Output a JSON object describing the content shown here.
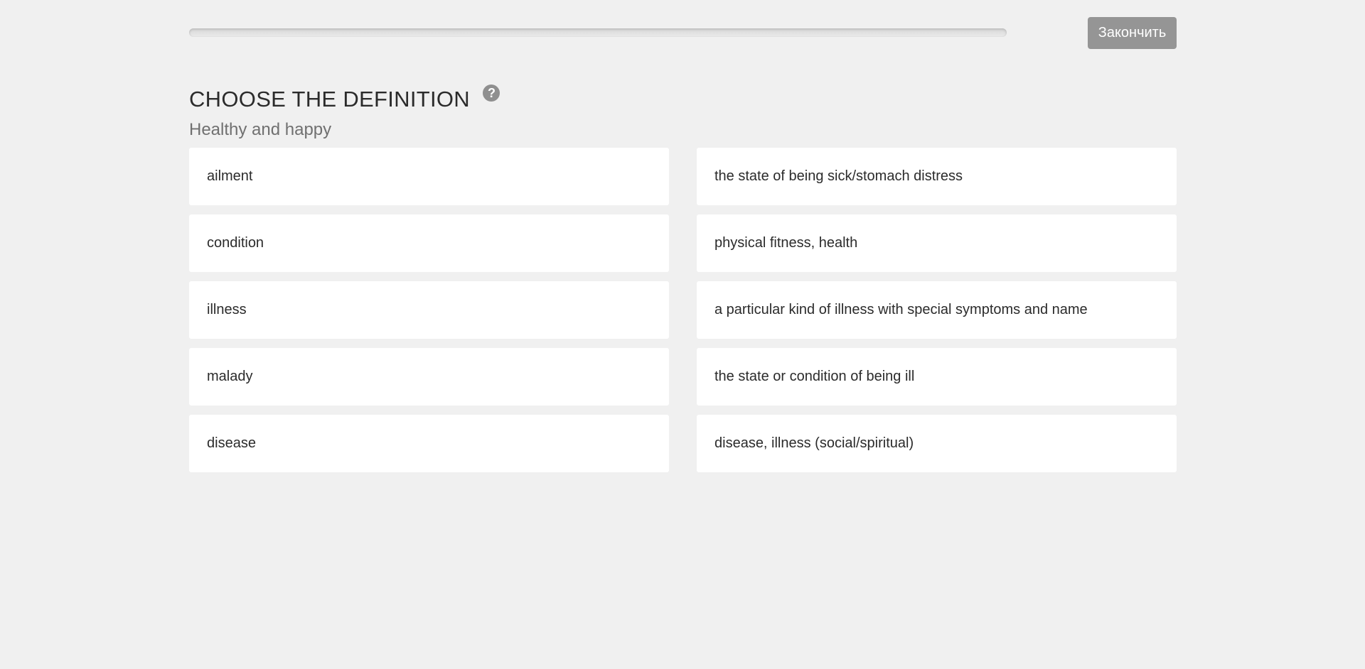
{
  "header": {
    "progress": 0,
    "finish_label": "Закончить"
  },
  "title": "CHOOSE THE DEFINITION",
  "help_icon": "question-circle-icon",
  "subtitle": "Healthy and happy",
  "terms": [
    {
      "label": "ailment"
    },
    {
      "label": "condition"
    },
    {
      "label": "illness"
    },
    {
      "label": "malady"
    },
    {
      "label": "disease"
    }
  ],
  "definitions": [
    {
      "label": "the state of being sick/stomach distress"
    },
    {
      "label": "physical fitness, health"
    },
    {
      "label": "a particular kind of illness with special symptoms and name"
    },
    {
      "label": "the state or condition of being ill"
    },
    {
      "label": "disease, illness (social/spiritual)"
    }
  ],
  "colors": {
    "background": "#f0f0f0",
    "card": "#ffffff",
    "button": "#959595",
    "help_icon": "#8f8f8f"
  }
}
